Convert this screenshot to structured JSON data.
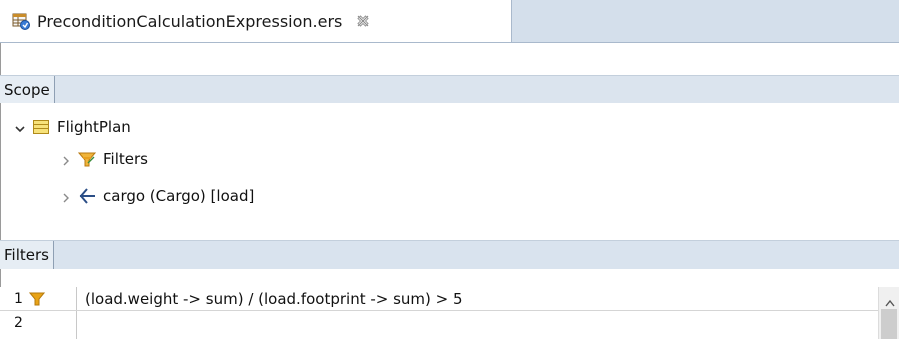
{
  "editor_tab": {
    "title": "PreconditionCalculationExpression.ers",
    "icon": "table-editor-icon",
    "close_icon": "close-icon"
  },
  "scope_section": {
    "label": "Scope",
    "tree": [
      {
        "label": "FlightPlan",
        "icon": "class-table-icon",
        "expanded": true
      },
      {
        "label": "Filters",
        "icon": "funnel-icon",
        "expanded": false
      },
      {
        "label": "cargo (Cargo) [load]",
        "icon": "reference-arrow-icon",
        "expanded": false
      }
    ]
  },
  "filters_section": {
    "label": "Filters",
    "rows": [
      {
        "number": "1",
        "expression": "(load.weight -> sum) / (load.footprint -> sum) > 5",
        "has_filter_icon": true
      },
      {
        "number": "2",
        "expression": "",
        "has_filter_icon": false
      }
    ]
  },
  "colors": {
    "tab_bar": "#d4dfeb",
    "section_header": "#dbe4ee",
    "filter_icon": "#e8a317"
  }
}
